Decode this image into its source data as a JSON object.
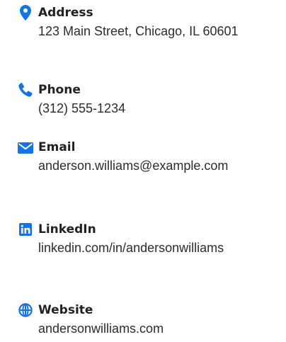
{
  "contact": {
    "accent_color": "#1473e6",
    "items": [
      {
        "label": "Address",
        "value": "123 Main Street, Chicago, IL 60601",
        "icon": "map-pin-icon"
      },
      {
        "label": "Phone",
        "value": "(312) 555-1234",
        "icon": "phone-icon"
      },
      {
        "label": "Email",
        "value": "anderson.williams@example.com",
        "icon": "envelope-icon"
      },
      {
        "label": "LinkedIn",
        "value": "linkedin.com/in/andersonwilliams",
        "icon": "linkedin-icon"
      },
      {
        "label": "Website",
        "value": "andersonwilliams.com",
        "icon": "globe-icon"
      }
    ]
  }
}
